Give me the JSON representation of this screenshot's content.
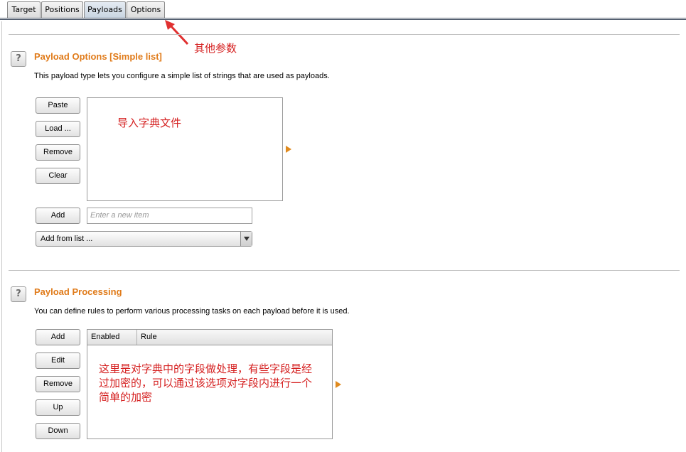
{
  "tabs": [
    {
      "label": "Target",
      "active": false
    },
    {
      "label": "Positions",
      "active": false
    },
    {
      "label": "Payloads",
      "active": true
    },
    {
      "label": "Options",
      "active": false
    }
  ],
  "payload_options": {
    "title": "Payload Options [Simple list]",
    "description": "This payload type lets you configure a simple list of strings that are used as payloads.",
    "buttons": {
      "paste": "Paste",
      "load": "Load ...",
      "remove": "Remove",
      "clear": "Clear",
      "add": "Add"
    },
    "new_item_placeholder": "Enter a new item",
    "add_from_list": "Add from list ..."
  },
  "payload_processing": {
    "title": "Payload Processing",
    "description": "You can define rules to perform various processing tasks on each payload before it is used.",
    "buttons": {
      "add": "Add",
      "edit": "Edit",
      "remove": "Remove",
      "up": "Up",
      "down": "Down"
    },
    "columns": [
      "Enabled",
      "Rule"
    ]
  },
  "annotations": {
    "options_note": "其他参数",
    "import_note": "导入字典文件",
    "processing_note_line1": "这里是对字典中的字段做处理，有些字段是经",
    "processing_note_line2": "过加密的，可以通过该选项对字段内进行一个",
    "processing_note_line3": "简单的加密"
  },
  "colors": {
    "accent": "#e07b1a",
    "annotation": "#d52020"
  }
}
